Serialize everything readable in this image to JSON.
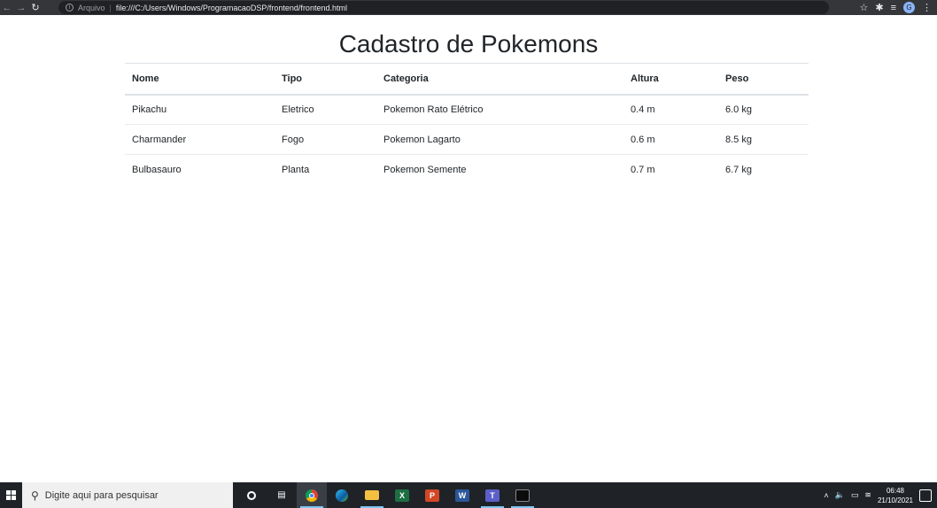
{
  "browser": {
    "back_icon": "arrow-left-icon",
    "forward_icon": "arrow-right-icon",
    "reload_icon": "reload-icon",
    "scheme_label": "Arquivo",
    "url": "file:///C:/Users/Windows/ProgramacaoDSP/frontend/frontend.html",
    "profile_initial": "G"
  },
  "page": {
    "title": "Cadastro de Pokemons"
  },
  "table": {
    "headers": [
      "Nome",
      "Tipo",
      "Categoria",
      "Altura",
      "Peso"
    ],
    "rows": [
      [
        "Pikachu",
        "Eletrico",
        "Pokemon Rato Elétrico",
        "0.4 m",
        "6.0 kg"
      ],
      [
        "Charmander",
        "Fogo",
        "Pokemon Lagarto",
        "0.6 m",
        "8.5 kg"
      ],
      [
        "Bulbasauro",
        "Planta",
        "Pokemon Semente",
        "0.7 m",
        "6.7 kg"
      ]
    ]
  },
  "taskbar": {
    "search_placeholder": "Digite aqui para pesquisar",
    "apps": [
      {
        "name": "task-view",
        "icon": "cortana-circle-icon"
      },
      {
        "name": "timeline",
        "icon": "task-view-icon"
      },
      {
        "name": "chrome",
        "icon": "chrome-icon"
      },
      {
        "name": "edge",
        "icon": "edge-icon"
      },
      {
        "name": "file-explorer",
        "icon": "folder-icon"
      },
      {
        "name": "excel",
        "icon": "excel-icon"
      },
      {
        "name": "powerpoint",
        "icon": "powerpoint-icon"
      },
      {
        "name": "word",
        "icon": "word-icon"
      },
      {
        "name": "teams",
        "icon": "teams-icon"
      },
      {
        "name": "terminal",
        "icon": "terminal-icon"
      }
    ],
    "time": "06:48",
    "date": "21/10/2021"
  },
  "colors": {
    "browser_bar": "#35363a",
    "taskbar": "#1f2328",
    "text": "#212529",
    "border": "#dee2e6"
  }
}
